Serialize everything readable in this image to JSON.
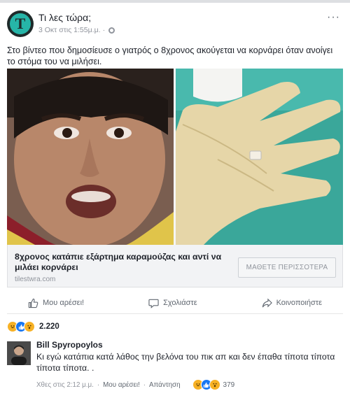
{
  "post": {
    "page_name": "Τι λες τώρα;",
    "timestamp": "3 Οκτ στις 1:55μ.μ.",
    "separator": "·",
    "avatar_letter": "T",
    "more_label": "···",
    "caption": "Στο βίντεο που δημοσίευσε ο γιατρός ο 8χρονος ακούγεται να κορνάρει όταν ανοίγει το στόμα του να μιλήσει."
  },
  "link_preview": {
    "title": "8χρονος κατάπιε εξάρτημα καραμούζας και αντί να μιλάει κορνάρει",
    "domain": "tilestwra.com",
    "button_label": "ΜΑΘΕΤΕ ΠΕΡΙΣΣΟΤΕΡΑ"
  },
  "actions": {
    "like": "Μου αρέσει!",
    "comment": "Σχολιάστε",
    "share": "Κοινοποιήστε"
  },
  "reactions": {
    "count": "2.220",
    "icons": [
      "haha-icon",
      "like-icon",
      "wow-icon"
    ]
  },
  "comment": {
    "author": "Bill Spyropoylos",
    "text": "Κι εγώ κατάπια κατά λάθος την βελόνα του πικ απ και δεν έπαθα τίποτα τίποτα τίποτα τίποτα. .",
    "time": "Χθες στις 2:12 μ.μ.",
    "like_link": "Μου αρέσει!",
    "reply_link": "Απάντηση",
    "reaction_count": "379"
  },
  "colors": {
    "accent": "#1877f2",
    "muted": "#90949c",
    "text": "#1d2129",
    "brand_teal": "#26b5a8"
  }
}
